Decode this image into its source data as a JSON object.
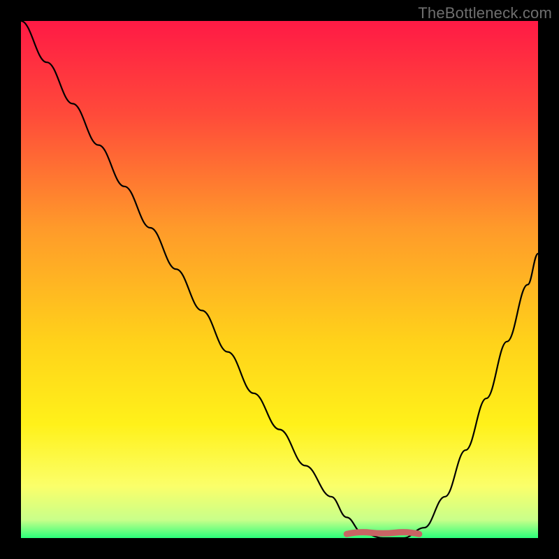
{
  "attribution": "TheBottleneck.com",
  "colors": {
    "frame": "#000000",
    "curve": "#000000",
    "marker": "#c86464",
    "gradient_stops": [
      {
        "offset": 0.0,
        "color": "#ff1a45"
      },
      {
        "offset": 0.18,
        "color": "#ff4a3a"
      },
      {
        "offset": 0.4,
        "color": "#ff9a2a"
      },
      {
        "offset": 0.62,
        "color": "#ffd21a"
      },
      {
        "offset": 0.78,
        "color": "#fff11a"
      },
      {
        "offset": 0.9,
        "color": "#fbff6a"
      },
      {
        "offset": 0.965,
        "color": "#c8ff8a"
      },
      {
        "offset": 1.0,
        "color": "#2bff7a"
      }
    ]
  },
  "chart_data": {
    "type": "line",
    "title": "",
    "xlabel": "",
    "ylabel": "",
    "x_range": [
      0,
      100
    ],
    "y_range": [
      0,
      100
    ],
    "grid": false,
    "legend": false,
    "annotations": [],
    "series": [
      {
        "name": "bottleneck-curve",
        "x": [
          0,
          5,
          10,
          15,
          20,
          25,
          30,
          35,
          40,
          45,
          50,
          55,
          60,
          63,
          66,
          70,
          74,
          78,
          82,
          86,
          90,
          94,
          98,
          100
        ],
        "y": [
          100,
          92,
          84,
          76,
          68,
          60,
          52,
          44,
          36,
          28,
          21,
          14,
          8,
          4,
          1,
          0,
          0,
          2,
          8,
          17,
          27,
          38,
          49,
          55
        ]
      }
    ],
    "flat_region": {
      "x_start": 63,
      "x_end": 77,
      "y": 0.5
    }
  }
}
